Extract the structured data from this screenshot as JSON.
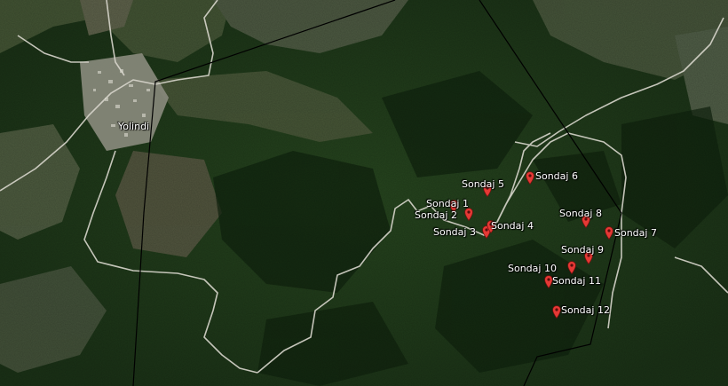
{
  "village": {
    "label": "Yolindi"
  },
  "pin_color": "#e53935",
  "markers": [
    {
      "id": "sondaj-1",
      "label": "Sondaj 1"
    },
    {
      "id": "sondaj-2",
      "label": "Sondaj 2"
    },
    {
      "id": "sondaj-3",
      "label": "Sondaj 3"
    },
    {
      "id": "sondaj-4",
      "label": "Sondaj 4"
    },
    {
      "id": "sondaj-5",
      "label": "Sondaj 5"
    },
    {
      "id": "sondaj-6",
      "label": "Sondaj 6"
    },
    {
      "id": "sondaj-7",
      "label": "Sondaj 7"
    },
    {
      "id": "sondaj-8",
      "label": "Sondaj 8"
    },
    {
      "id": "sondaj-9",
      "label": "Sondaj 9"
    },
    {
      "id": "sondaj-10",
      "label": "Sondaj 10"
    },
    {
      "id": "sondaj-11",
      "label": "Sondaj 11"
    },
    {
      "id": "sondaj-12",
      "label": "Sondaj 12"
    }
  ]
}
